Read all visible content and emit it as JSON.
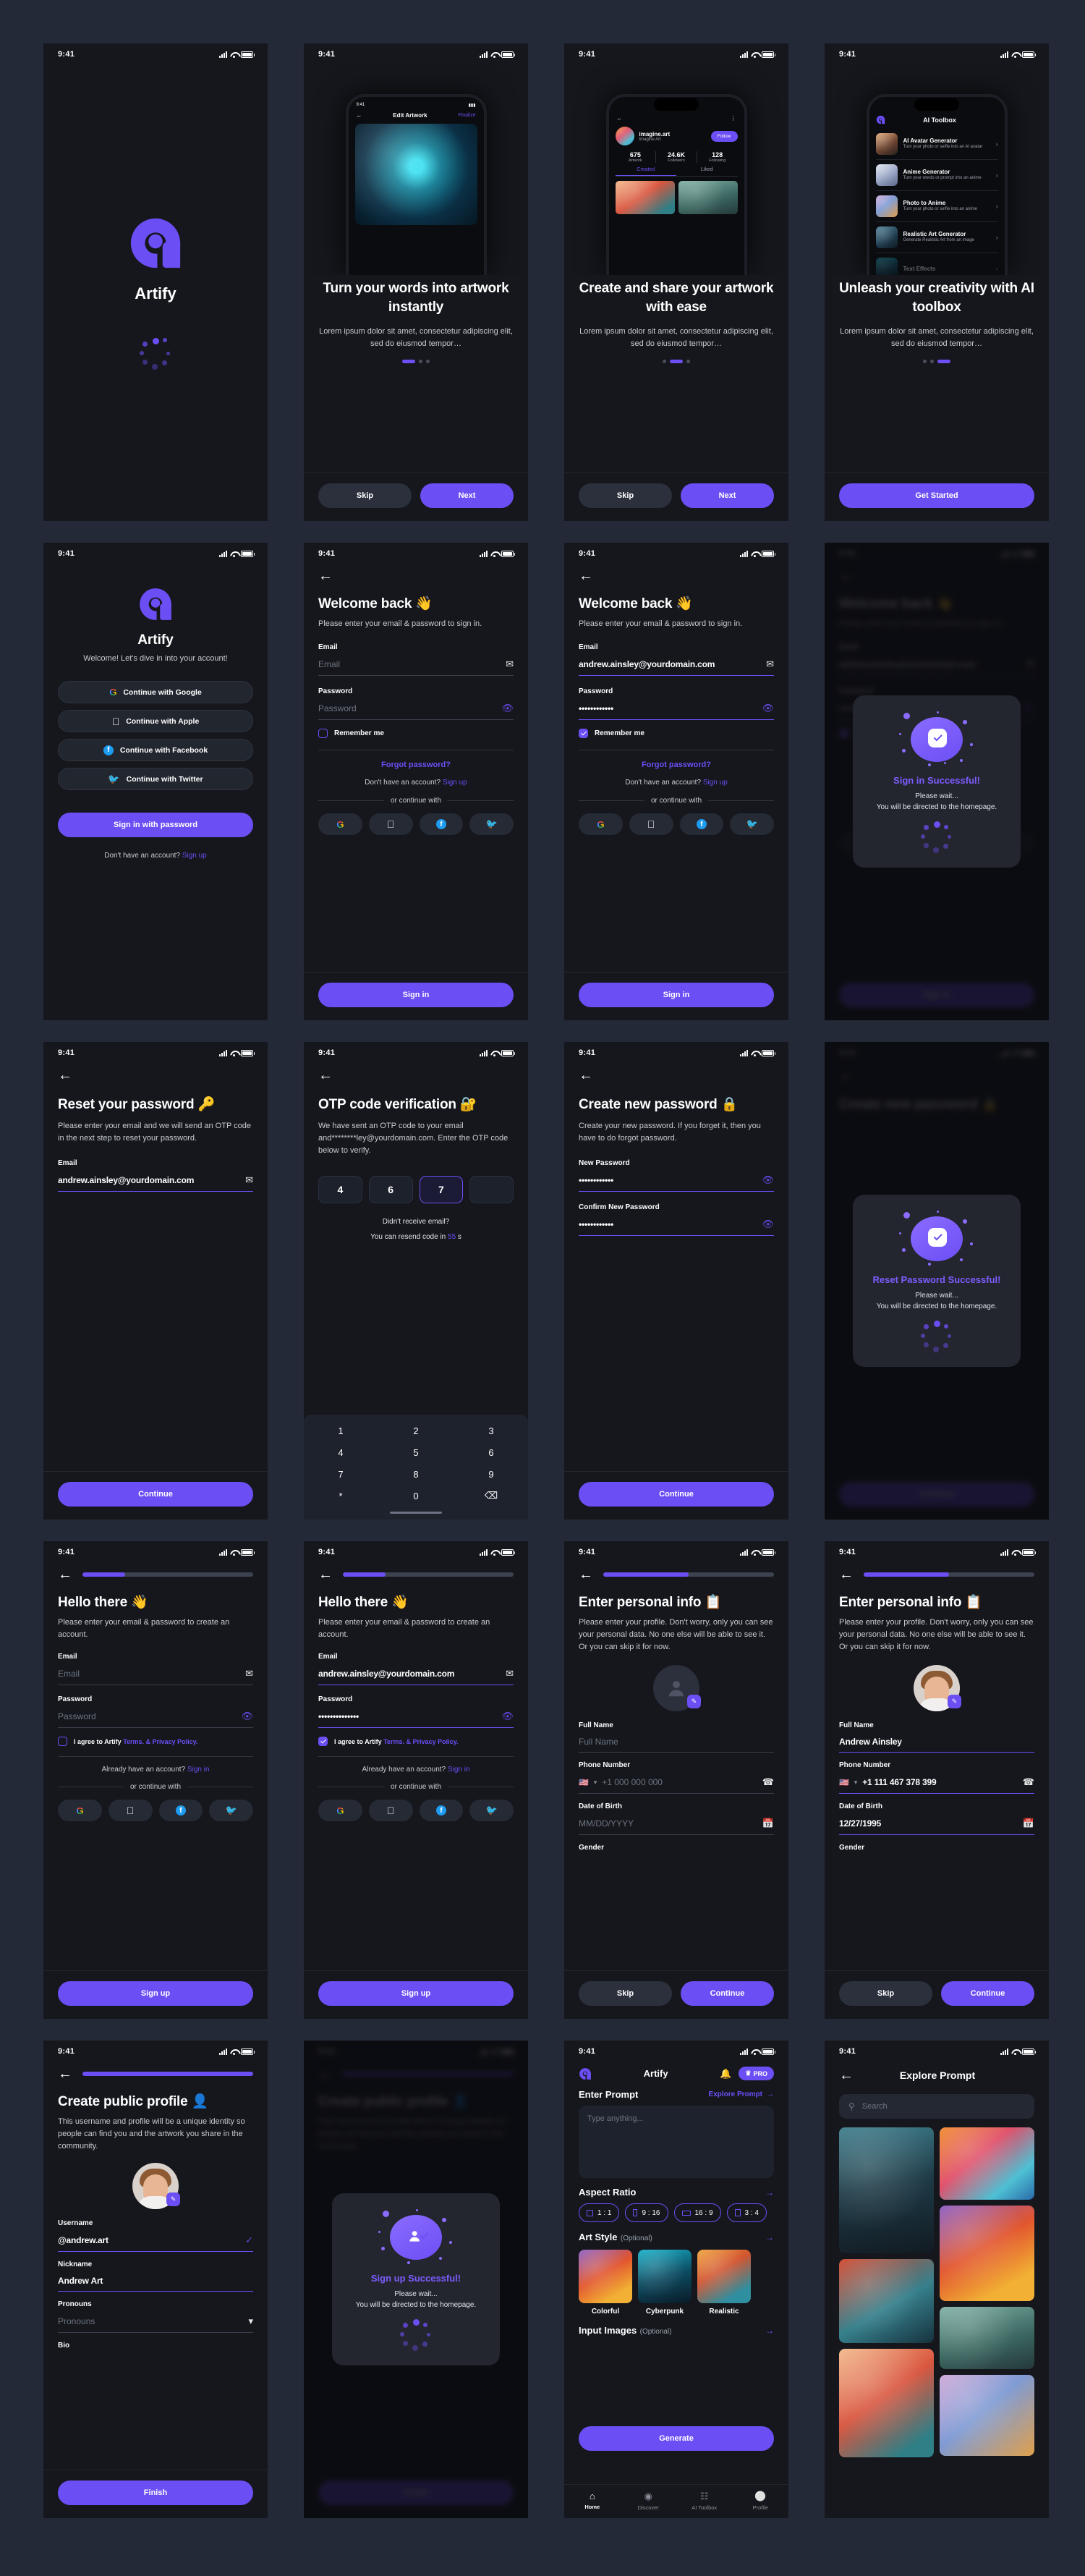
{
  "status_bar": {
    "time": "9:41"
  },
  "brand": {
    "name": "Artify",
    "accent": "#6c4ef5"
  },
  "s1_splash": {
    "app_name": "Artify"
  },
  "s2_onboard1": {
    "title": "Turn your words into artwork instantly",
    "desc": "Lorem ipsum dolor sit amet, consectetur adipiscing elit, sed do eiusmod tempor…",
    "skip": "Skip",
    "next": "Next",
    "mock": {
      "title": "Edit Artwork",
      "action": "Finalize"
    }
  },
  "s3_onboard2": {
    "title": "Create and share your artwork with ease",
    "desc": "Lorem ipsum dolor sit amet, consectetur adipiscing elit, sed do eiusmod tempor…",
    "skip": "Skip",
    "next": "Next",
    "mock": {
      "handle": "imagine.art",
      "display_name": "Imagine Art",
      "follow": "Follow",
      "stats": [
        {
          "value": "675",
          "label": "Artwork"
        },
        {
          "value": "24.6K",
          "label": "Followers"
        },
        {
          "value": "128",
          "label": "Following"
        }
      ],
      "tabs": [
        "Created",
        "Liked"
      ]
    }
  },
  "s4_onboard3": {
    "title": "Unleash your creativity with AI toolbox",
    "desc": "Lorem ipsum dolor sit amet, consectetur adipiscing elit, sed do eiusmod tempor…",
    "cta": "Get Started",
    "mock": {
      "title": "AI Toolbox",
      "tools": [
        {
          "name": "AI Avatar Generator",
          "desc": "Turn your photo or selfie into an AI avatar"
        },
        {
          "name": "Anime Generator",
          "desc": "Turn your words or prompt into an anime"
        },
        {
          "name": "Photo to Anime",
          "desc": "Turn your photo or selfie into an anime"
        },
        {
          "name": "Realistic Art Generator",
          "desc": "Generate Realistic Art from an image"
        },
        {
          "name": "Text Effects",
          "desc": ""
        }
      ]
    }
  },
  "s5_welcome": {
    "app_name": "Artify",
    "tagline": "Welcome! Let's dive in into your account!",
    "social_buttons": [
      {
        "label": "Continue with Google",
        "icon": "google-icon"
      },
      {
        "label": "Continue with Apple",
        "icon": "apple-icon"
      },
      {
        "label": "Continue with Facebook",
        "icon": "facebook-icon"
      },
      {
        "label": "Continue with Twitter",
        "icon": "twitter-icon"
      }
    ],
    "primary": "Sign in with password",
    "footer_text": "Don't have an account?",
    "footer_link": "Sign up"
  },
  "s6_signin_empty": {
    "title": "Welcome back 👋",
    "subtitle": "Please enter your email & password to sign in.",
    "email_label": "Email",
    "email_placeholder": "Email",
    "password_label": "Password",
    "password_placeholder": "Password",
    "remember": "Remember me",
    "forgot": "Forgot password?",
    "no_account": "Don't have an account?",
    "signup_link": "Sign up",
    "divider": "or continue with",
    "cta": "Sign in"
  },
  "s7_signin_filled": {
    "title": "Welcome back 👋",
    "subtitle": "Please enter your email & password to sign in.",
    "email_label": "Email",
    "email_value": "andrew.ainsley@yourdomain.com",
    "password_label": "Password",
    "password_value": "••••••••••••",
    "remember": "Remember me",
    "forgot": "Forgot password?",
    "no_account": "Don't have an account?",
    "signup_link": "Sign up",
    "divider": "or continue with",
    "cta": "Sign in"
  },
  "s8_signin_success": {
    "modal_title": "Sign in Successful!",
    "modal_line1": "Please wait...",
    "modal_line2": "You will be directed to the homepage.",
    "bg_title": "Welcome back 👋",
    "bg_subtitle": "Please enter your email & password to sign in.",
    "cta": "Sign in"
  },
  "s9_reset": {
    "title": "Reset your password 🔑",
    "subtitle": "Please enter your email and we will send an OTP code in the next step to reset your password.",
    "email_label": "Email",
    "email_value": "andrew.ainsley@yourdomain.com",
    "cta": "Continue"
  },
  "s10_otp": {
    "title": "OTP code verification 🔐",
    "subtitle": "We have sent an OTP code to your email and********ley@yourdomain.com. Enter the OTP code below to verify.",
    "digits": [
      "4",
      "6",
      "7",
      ""
    ],
    "selected_index": 2,
    "didnt_receive": "Didn't receive email?",
    "resend_prefix": "You can resend code in",
    "resend_seconds": "55",
    "resend_suffix": "s",
    "keypad": [
      "1",
      "2",
      "3",
      "4",
      "5",
      "6",
      "7",
      "8",
      "9",
      "*",
      "0",
      "⌫"
    ]
  },
  "s11_newpass": {
    "title": "Create new password 🔒",
    "subtitle": "Create your new password. If you forget it, then you have to do forgot password.",
    "new_label": "New Password",
    "new_value": "••••••••••••",
    "confirm_label": "Confirm New Password",
    "confirm_value": "••••••••••••",
    "cta": "Continue"
  },
  "s12_reset_success": {
    "bg_title": "Create new password 🔒",
    "modal_title": "Reset Password Successful!",
    "modal_line1": "Please wait...",
    "modal_line2": "You will be directed to the homepage.",
    "cta": "Continue"
  },
  "s13_signup_empty": {
    "title": "Hello there 👋",
    "subtitle": "Please enter your email & password to create an account.",
    "email_label": "Email",
    "email_placeholder": "Email",
    "password_label": "Password",
    "password_placeholder": "Password",
    "agree_prefix": "I agree to Artify",
    "agree_link": "Terms. & Privacy Policy.",
    "have_account": "Already have an account?",
    "signin_link": "Sign in",
    "divider": "or continue with",
    "cta": "Sign up",
    "progress": 25
  },
  "s14_signup_filled": {
    "title": "Hello there 👋",
    "subtitle": "Please enter your email & password to create an account.",
    "email_label": "Email",
    "email_value": "andrew.ainsley@yourdomain.com",
    "password_label": "Password",
    "password_value": "••••••••••••••",
    "agree_prefix": "I agree to Artify",
    "agree_link": "Terms. & Privacy Policy.",
    "have_account": "Already have an account?",
    "signin_link": "Sign in",
    "divider": "or continue with",
    "cta": "Sign up",
    "progress": 25
  },
  "s15_personal_empty": {
    "title": "Enter personal info 📋",
    "subtitle": "Please enter your profile. Don't worry, only you can see your personal data. No one else will be able to see it. Or you can skip it for now.",
    "fullname_label": "Full Name",
    "fullname_placeholder": "Full Name",
    "phone_label": "Phone Number",
    "phone_placeholder": "+1 000 000 000",
    "dob_label": "Date of Birth",
    "dob_placeholder": "MM/DD/YYYY",
    "gender_label": "Gender",
    "skip": "Skip",
    "continue": "Continue",
    "progress": 50
  },
  "s16_personal_filled": {
    "title": "Enter personal info 📋",
    "subtitle": "Please enter your profile. Don't worry, only you can see your personal data. No one else will be able to see it. Or you can skip it for now.",
    "fullname_label": "Full Name",
    "fullname_value": "Andrew Ainsley",
    "phone_label": "Phone Number",
    "phone_value": "+1 111 467 378 399",
    "dob_label": "Date of Birth",
    "dob_value": "12/27/1995",
    "gender_label": "Gender",
    "skip": "Skip",
    "continue": "Continue",
    "progress": 50
  },
  "s17_public_profile": {
    "title": "Create public profile 👤",
    "subtitle": "This username and profile will be a unique identity so people can find you and the artwork you share in the community.",
    "username_label": "Username",
    "username_value": "@andrew.art",
    "nickname_label": "Nickname",
    "nickname_value": "Andrew Art",
    "pronouns_label": "Pronouns",
    "pronouns_placeholder": "Pronouns",
    "bio_label": "Bio",
    "cta": "Finish",
    "progress": 100
  },
  "s18_signup_success": {
    "bg_title": "Create public profile 👤",
    "bg_subtitle": "This username and profile will be a unique identity so people can find you and the artwork you share in the community.",
    "modal_title": "Sign up Successful!",
    "modal_line1": "Please wait...",
    "modal_line2": "You will be directed to the homepage.",
    "cta": "Finish"
  },
  "s19_home": {
    "app_title": "Artify",
    "pro_badge": "PRO",
    "prompt_heading": "Enter Prompt",
    "explore_link": "Explore Prompt",
    "prompt_placeholder": "Type anything...",
    "aspect_heading": "Aspect Ratio",
    "aspect_options": [
      "1 : 1",
      "9 : 16",
      "16 : 9",
      "3 : 4"
    ],
    "style_heading": "Art Style",
    "style_optional": "(Optional)",
    "styles": [
      "Colorful",
      "Cyberpunk",
      "Realistic"
    ],
    "input_images_heading": "Input Images",
    "input_images_optional": "(Optional)",
    "generate": "Generate",
    "tabs": [
      {
        "label": "Home",
        "icon": "home-icon"
      },
      {
        "label": "Discover",
        "icon": "compass-icon"
      },
      {
        "label": "AI Toolbox",
        "icon": "grid-icon"
      },
      {
        "label": "Profile",
        "icon": "person-icon"
      }
    ]
  },
  "s20_explore": {
    "title": "Explore Prompt",
    "search_placeholder": "Search",
    "gallery_left": [
      "robot-in-rain",
      "dragon-portrait",
      "woman-portrait"
    ],
    "gallery_right": [
      "flower-crown-woman",
      "angry-bird",
      "box-robot",
      "elderly-woman"
    ]
  }
}
